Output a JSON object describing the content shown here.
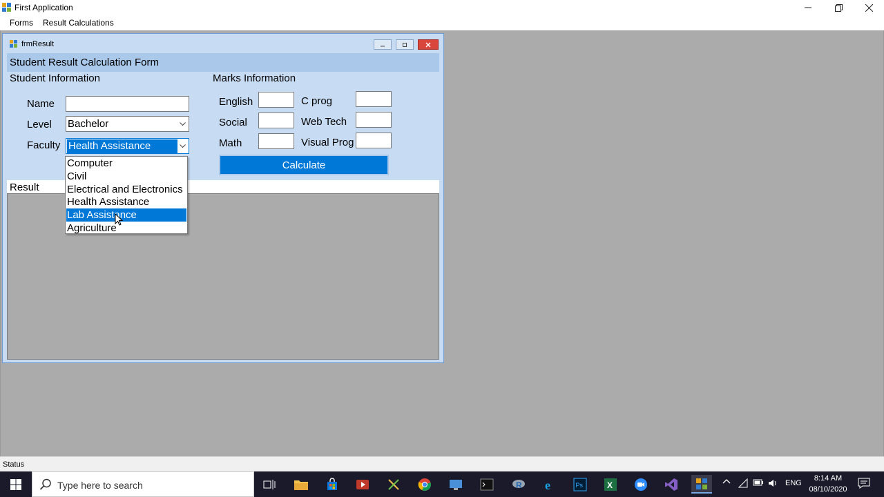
{
  "app": {
    "title": "First Application",
    "menu": [
      "Forms",
      "Result Calculations"
    ],
    "status": "Status"
  },
  "form": {
    "title": "frmResult",
    "heading": "Student Result Calculation Form",
    "student_panel": {
      "title": "Student Information",
      "name_label": "Name",
      "name_value": "",
      "level_label": "Level",
      "level_value": "Bachelor",
      "faculty_label": "Faculty",
      "faculty_value": "Health Assistance"
    },
    "marks_panel": {
      "title": "Marks Information",
      "subjects": [
        "English",
        "Social",
        "Math",
        "C prog",
        "Web Tech",
        "Visual Prog"
      ]
    },
    "calculate_label": "Calculate",
    "result_label": "Result"
  },
  "faculty_dropdown": {
    "options": [
      "Computer",
      "Civil",
      "Electrical and Electronics",
      "Health Assistance",
      "Lab Assistance",
      "Agriculture"
    ],
    "highlighted": "Lab Assistance"
  },
  "taskbar": {
    "search_placeholder": "Type here to search",
    "language": "ENG",
    "time": "8:14 AM",
    "date": "08/10/2020"
  }
}
